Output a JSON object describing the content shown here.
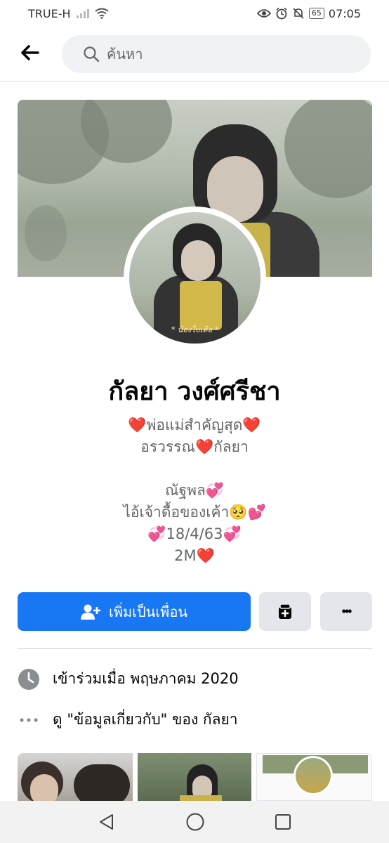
{
  "status_bar": {
    "carrier": "TRUE-H",
    "battery": "65",
    "time": "07:05"
  },
  "search": {
    "placeholder": "ค้นหา"
  },
  "cover": {
    "avatar_caption": "* น้องใบเตือ *"
  },
  "profile": {
    "name": "กัลยา วงศ์ศรีชา",
    "bio_lines": [
      "❤️พ่อแม่สำคัญสุด❤️",
      "อรวรรณ❤️กัลยา",
      "",
      "ณัฐพล💞",
      "ไอ้เจ้าดื้อของเค้า🥺💕",
      "💞18/4/63💞",
      "2M❤️"
    ]
  },
  "actions": {
    "add_friend_label": "เพิ่มเป็นเพื่อน",
    "more_label": "•••"
  },
  "info": {
    "joined": "เข้าร่วมเมื่อ พฤษภาคม  2020",
    "about_link": "ดู \"ข้อมูลเกี่ยวกับ\" ของ กัลยา"
  },
  "colors": {
    "primary": "#1877f2",
    "secondary_bg": "#e4e6eb",
    "text_muted": "#65676b"
  }
}
